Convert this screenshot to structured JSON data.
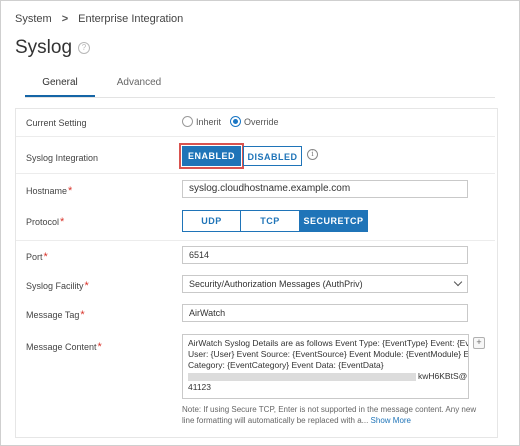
{
  "breadcrumb": {
    "root": "System",
    "current": "Enterprise Integration"
  },
  "page_title": "Syslog",
  "tabs": [
    {
      "label": "General",
      "active": true
    },
    {
      "label": "Advanced",
      "active": false
    }
  ],
  "form": {
    "current_setting": {
      "label": "Current Setting",
      "options": [
        "Inherit",
        "Override"
      ],
      "selected": "Override"
    },
    "syslog_integration": {
      "label": "Syslog Integration",
      "enabled_label": "ENABLED",
      "disabled_label": "DISABLED",
      "selected": "ENABLED"
    },
    "hostname": {
      "label": "Hostname",
      "required": "*",
      "value": "syslog.cloudhostname.example.com"
    },
    "protocol": {
      "label": "Protocol",
      "required": "*",
      "options": [
        "UDP",
        "TCP",
        "SECURETCP"
      ],
      "selected": "SECURETCP"
    },
    "port": {
      "label": "Port",
      "required": "*",
      "value": "6514"
    },
    "syslog_facility": {
      "label": "Syslog Facility",
      "required": "*",
      "value": "Security/Authorization Messages (AuthPriv)"
    },
    "message_tag": {
      "label": "Message Tag",
      "required": "*",
      "value": "AirWatch"
    },
    "message_content": {
      "label": "Message Content",
      "required": "*",
      "line1": "AirWatch Syslog Details are as follows Event Type: {EventType} Event: {Event}",
      "line2": "User: {User} Event Source: {EventSource} Event Module: {EventModule} Event",
      "line3": "Category: {EventCategory} Event Data: {EventData}",
      "line4_tail": "kwH6KBtS@",
      "line5": "41123"
    },
    "note": "Note: If using Secure TCP, Enter is not supported in the message content. Any new line formatting will automatically be replaced with a...",
    "show_more": "Show More"
  },
  "colors": {
    "accent": "#1f74b8",
    "highlight": "#d9534f",
    "required": "#d9342b"
  }
}
